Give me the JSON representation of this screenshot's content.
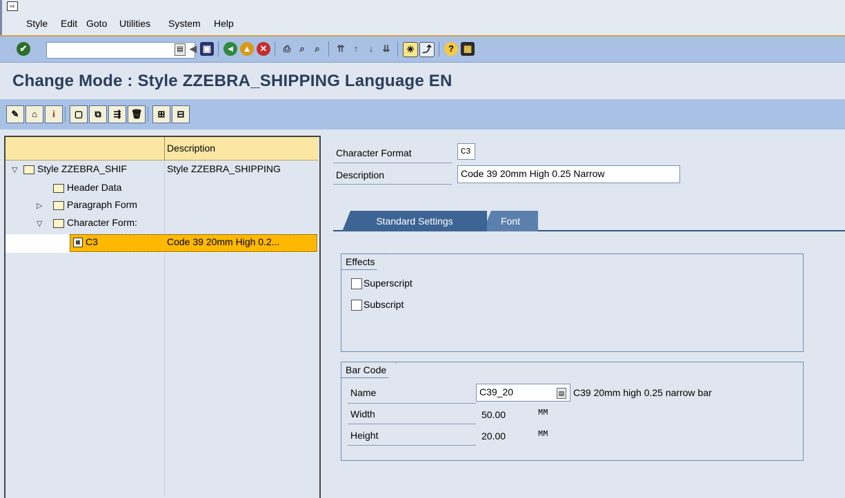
{
  "menu": {
    "system_icon": "exit-icon",
    "items": [
      {
        "label": "Style"
      },
      {
        "label": "Edit"
      },
      {
        "label": "Goto"
      },
      {
        "label": "Utilities"
      },
      {
        "label": "System"
      },
      {
        "label": "Help"
      }
    ]
  },
  "toolbar": {
    "command_field_value": "",
    "icons": [
      "enter-icon",
      "back-icon",
      "save-icon",
      "back-nav-icon",
      "exit-nav-icon",
      "cancel-icon",
      "print-icon",
      "find-icon",
      "find-next-icon",
      "first-page-icon",
      "prev-page-icon",
      "next-page-icon",
      "last-page-icon",
      "create-session-icon",
      "shortcut-icon",
      "help-icon",
      "layout-icon"
    ]
  },
  "title": "Change Mode : Style ZZEBRA_SHIPPING Language EN",
  "app_toolbar": {
    "icons": [
      "display-change-icon",
      "header-icon",
      "info-icon",
      "create-icon",
      "copy-icon",
      "execute-icon",
      "delete-icon",
      "expand-icon",
      "collapse-icon"
    ]
  },
  "tree": {
    "column_header": "Description",
    "rows": [
      {
        "name": "Style ZZEBRA_SHIF",
        "desc": "Style ZZEBRA_SHIPPING"
      },
      {
        "name": "Header Data",
        "desc": ""
      },
      {
        "name": "Paragraph Form",
        "desc": ""
      },
      {
        "name": "Character Form:",
        "desc": ""
      },
      {
        "name": "C3",
        "desc": "Code 39 20mm High 0.2..."
      }
    ]
  },
  "detail": {
    "char_format_label": "Character Format",
    "char_format_value": "C3",
    "description_label": "Description",
    "description_value": "Code 39 20mm High 0.25 Narrow",
    "tabs": [
      {
        "label": "Standard Settings",
        "active": true
      },
      {
        "label": "Font",
        "active": false
      }
    ],
    "effects": {
      "title": "Effects",
      "superscript_label": "Superscript",
      "superscript_checked": false,
      "subscript_label": "Subscript",
      "subscript_checked": false
    },
    "barcode": {
      "title": "Bar Code",
      "name_label": "Name",
      "name_value": "C39_20",
      "name_desc": "C39 20mm high 0.25 narrow bar",
      "width_label": "Width",
      "width_value": "50.00",
      "width_unit": "MM",
      "height_label": "Height",
      "height_value": "20.00",
      "height_unit": "MM"
    }
  },
  "colors": {
    "toolbar_bg": "#a8c1e5",
    "title_color": "#2a3e5c",
    "tree_header_bg": "#fbe7a3",
    "selection_bg": "#ffb800",
    "tab_active_bg": "#3d6494"
  }
}
